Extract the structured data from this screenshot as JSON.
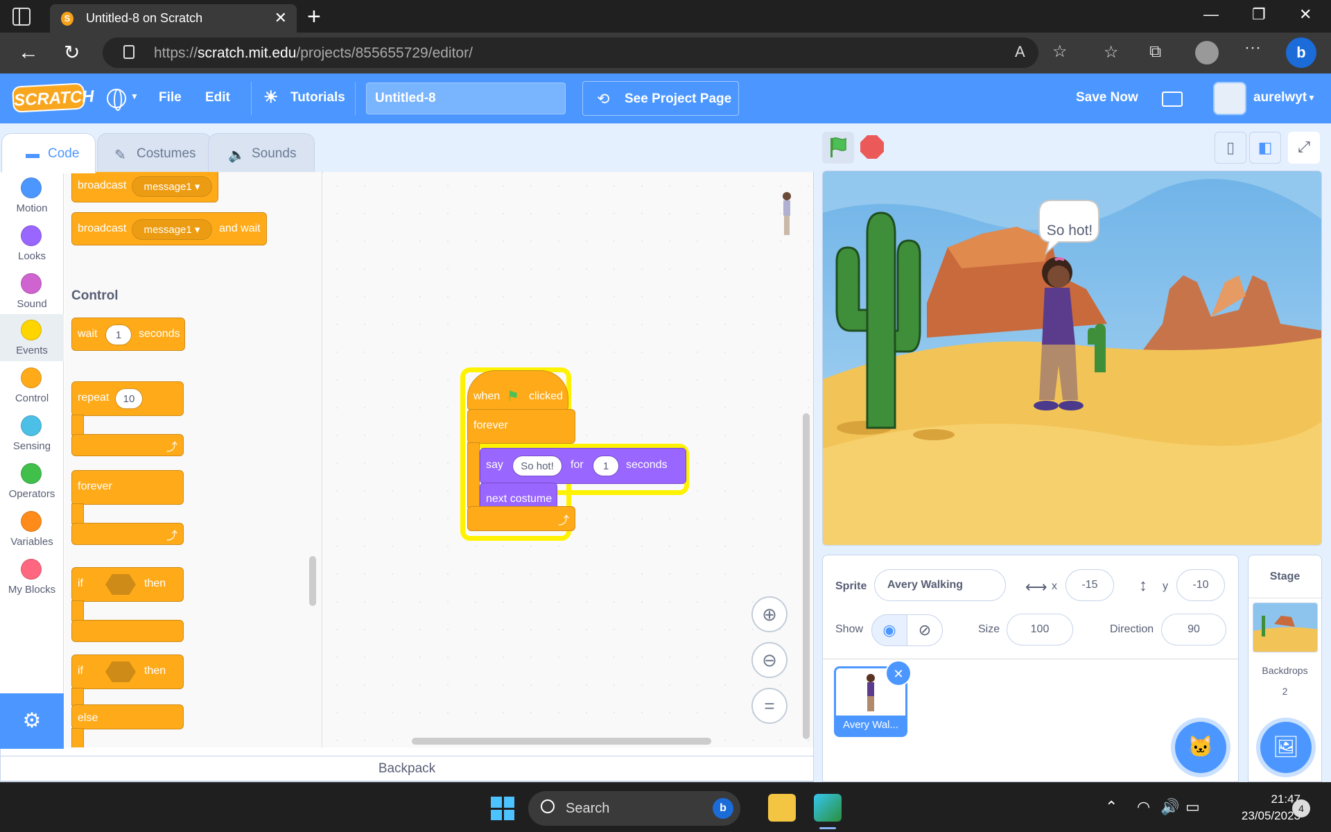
{
  "browser": {
    "tab_title": "Untitled-8 on Scratch",
    "url_prefix": "https://",
    "url_domain": "scratch.mit.edu",
    "url_path": "/projects/855655729/editor/"
  },
  "menubar": {
    "logo_text": "SCRATCH",
    "file": "File",
    "edit": "Edit",
    "tutorials": "Tutorials",
    "project_title": "Untitled-8",
    "see_project_page": "See Project Page",
    "save_now": "Save Now",
    "username": "aurelwyt"
  },
  "editor_tabs": {
    "code": "Code",
    "costumes": "Costumes",
    "sounds": "Sounds"
  },
  "categories": [
    {
      "label": "Motion",
      "color": "#4c97ff"
    },
    {
      "label": "Looks",
      "color": "#9966ff"
    },
    {
      "label": "Sound",
      "color": "#cf63cf"
    },
    {
      "label": "Events",
      "color": "#ffd500"
    },
    {
      "label": "Control",
      "color": "#ffab19"
    },
    {
      "label": "Sensing",
      "color": "#4cbfe6"
    },
    {
      "label": "Operators",
      "color": "#40bf4a"
    },
    {
      "label": "Variables",
      "color": "#ff8c1a"
    },
    {
      "label": "My Blocks",
      "color": "#ff6680"
    }
  ],
  "palette": {
    "broadcast": "broadcast",
    "broadcast_msg": "message1",
    "broadcast_wait": "broadcast",
    "broadcast_wait_msg": "message1",
    "and_wait": "and wait",
    "control_heading": "Control",
    "wait": "wait",
    "wait_value": "1",
    "seconds": "seconds",
    "repeat": "repeat",
    "repeat_value": "10",
    "forever": "forever",
    "if1": "if",
    "then1": "then",
    "if2": "if",
    "then2": "then",
    "else": "else"
  },
  "script": {
    "when": "when",
    "clicked": "clicked",
    "forever": "forever",
    "say": "say",
    "say_text": "So hot!",
    "for": "for",
    "for_value": "1",
    "seconds": "seconds",
    "next_costume": "next costume"
  },
  "backpack": "Backpack",
  "stage": {
    "speech": "So hot!"
  },
  "sprite_info": {
    "sprite_label": "Sprite",
    "sprite_name": "Avery Walking",
    "x_label": "x",
    "x_value": "-15",
    "y_label": "y",
    "y_value": "-10",
    "show_label": "Show",
    "size_label": "Size",
    "size_value": "100",
    "direction_label": "Direction",
    "direction_value": "90"
  },
  "sprite_list": [
    {
      "name": "Avery Wal..."
    }
  ],
  "stage_pane": {
    "title": "Stage",
    "backdrops_label": "Backdrops",
    "backdrops_count": "2"
  },
  "taskbar": {
    "search": "Search",
    "time": "21:47",
    "date": "23/05/2023",
    "notifications": "4"
  },
  "colors": {
    "scratch_blue": "#4c97ff",
    "control_orange": "#ffab19",
    "looks_purple": "#9966ff",
    "glow_yellow": "#fff200"
  }
}
